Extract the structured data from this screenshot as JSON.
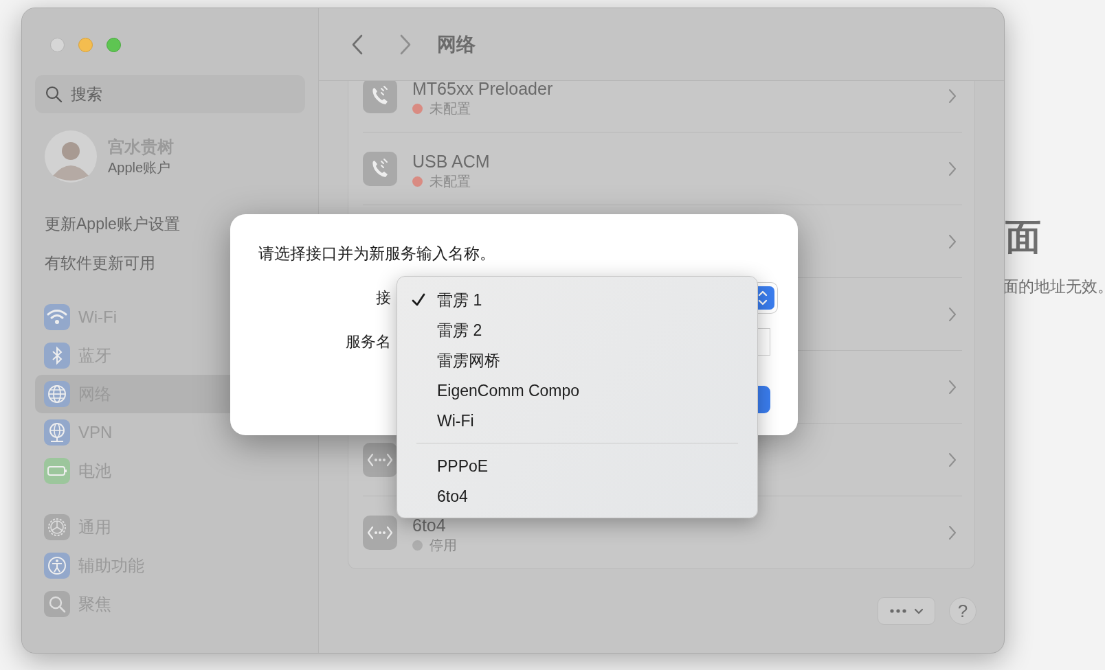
{
  "background_window": {
    "heading": "面",
    "text": "面的地址无效。"
  },
  "sidebar": {
    "search": {
      "placeholder": "搜索"
    },
    "account": {
      "name": "宫水贵树",
      "subtitle": "Apple账户"
    },
    "notices": [
      "更新Apple账户设置",
      "有软件更新可用"
    ],
    "groups": [
      [
        {
          "label": "Wi-Fi",
          "kind": "wifi",
          "selected": false
        },
        {
          "label": "蓝牙",
          "kind": "bluetooth",
          "selected": false
        },
        {
          "label": "网络",
          "kind": "globe",
          "selected": true
        },
        {
          "label": "VPN",
          "kind": "vpn",
          "selected": false
        },
        {
          "label": "电池",
          "kind": "battery",
          "selected": false
        }
      ],
      [
        {
          "label": "通用",
          "kind": "gear",
          "selected": false
        },
        {
          "label": "辅助功能",
          "kind": "accessibility",
          "selected": false
        },
        {
          "label": "聚焦",
          "kind": "search",
          "selected": false
        }
      ]
    ]
  },
  "header": {
    "title": "网络"
  },
  "services": [
    {
      "kind": "phone",
      "name": "MT65xx Preloader",
      "status": "未配置",
      "color": "#d98b82"
    },
    {
      "kind": "phone",
      "name": "USB ACM",
      "status": "未配置",
      "color": "#d98b82"
    },
    {
      "kind": "hidden"
    },
    {
      "kind": "hidden"
    },
    {
      "kind": "hidden"
    },
    {
      "kind": "tunnel"
    },
    {
      "kind": "tunnel",
      "name": "6to4",
      "status": "停用",
      "color": "#adadad"
    }
  ],
  "footer": {
    "help": "?"
  },
  "dialog": {
    "message": "请选择接口并为新服务输入名称。",
    "interface_label": "接",
    "name_label": "服务名"
  },
  "interface_menu": [
    {
      "kind": "item",
      "label": "雷雳 1",
      "checked": true
    },
    {
      "kind": "item",
      "label": "雷雳 2",
      "checked": false
    },
    {
      "kind": "item",
      "label": "雷雳网桥",
      "checked": false
    },
    {
      "kind": "item",
      "label": "EigenComm Compo",
      "checked": false
    },
    {
      "kind": "item",
      "label": "Wi-Fi",
      "checked": false
    },
    {
      "kind": "separator"
    },
    {
      "kind": "item",
      "label": "PPPoE",
      "checked": false
    },
    {
      "kind": "item",
      "label": "6to4",
      "checked": false
    }
  ]
}
